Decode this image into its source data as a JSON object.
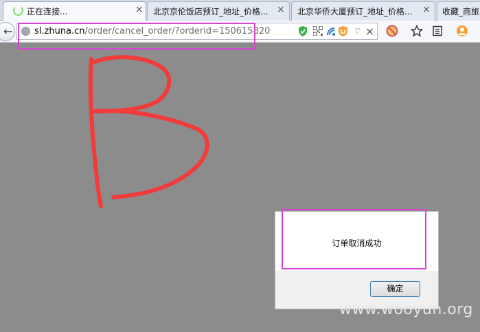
{
  "tabs": [
    {
      "label": "正在连接...",
      "active": true
    },
    {
      "label": "北京京伦饭店预订_地址_价格...",
      "active": false
    },
    {
      "label": "北京华侨大厦预订_地址_价格...",
      "active": false
    },
    {
      "label": "收藏_商旅",
      "active": false
    }
  ],
  "tab_close_glyph": "×",
  "address_bar": {
    "host": "sl.zhuna.cn",
    "path": "/order/cancel_order/?orderid=150615820",
    "stop_glyph": "×"
  },
  "nav": {
    "back_glyph": "←"
  },
  "annotation": {
    "letter": "B",
    "stroke_color": "#f23b3b",
    "highlight_color": "#d944d4"
  },
  "dialog": {
    "message": "订单取消成功",
    "ok_label": "确定"
  },
  "watermark": "www.wooyun.org",
  "icons": [
    "globe-icon",
    "shield-check-icon",
    "qr-code-icon",
    "network-icon",
    "extension-shield-icon",
    "dropdown-icon",
    "stop-icon",
    "block-icon",
    "star-icon",
    "reading-list-icon",
    "profile-icon"
  ]
}
